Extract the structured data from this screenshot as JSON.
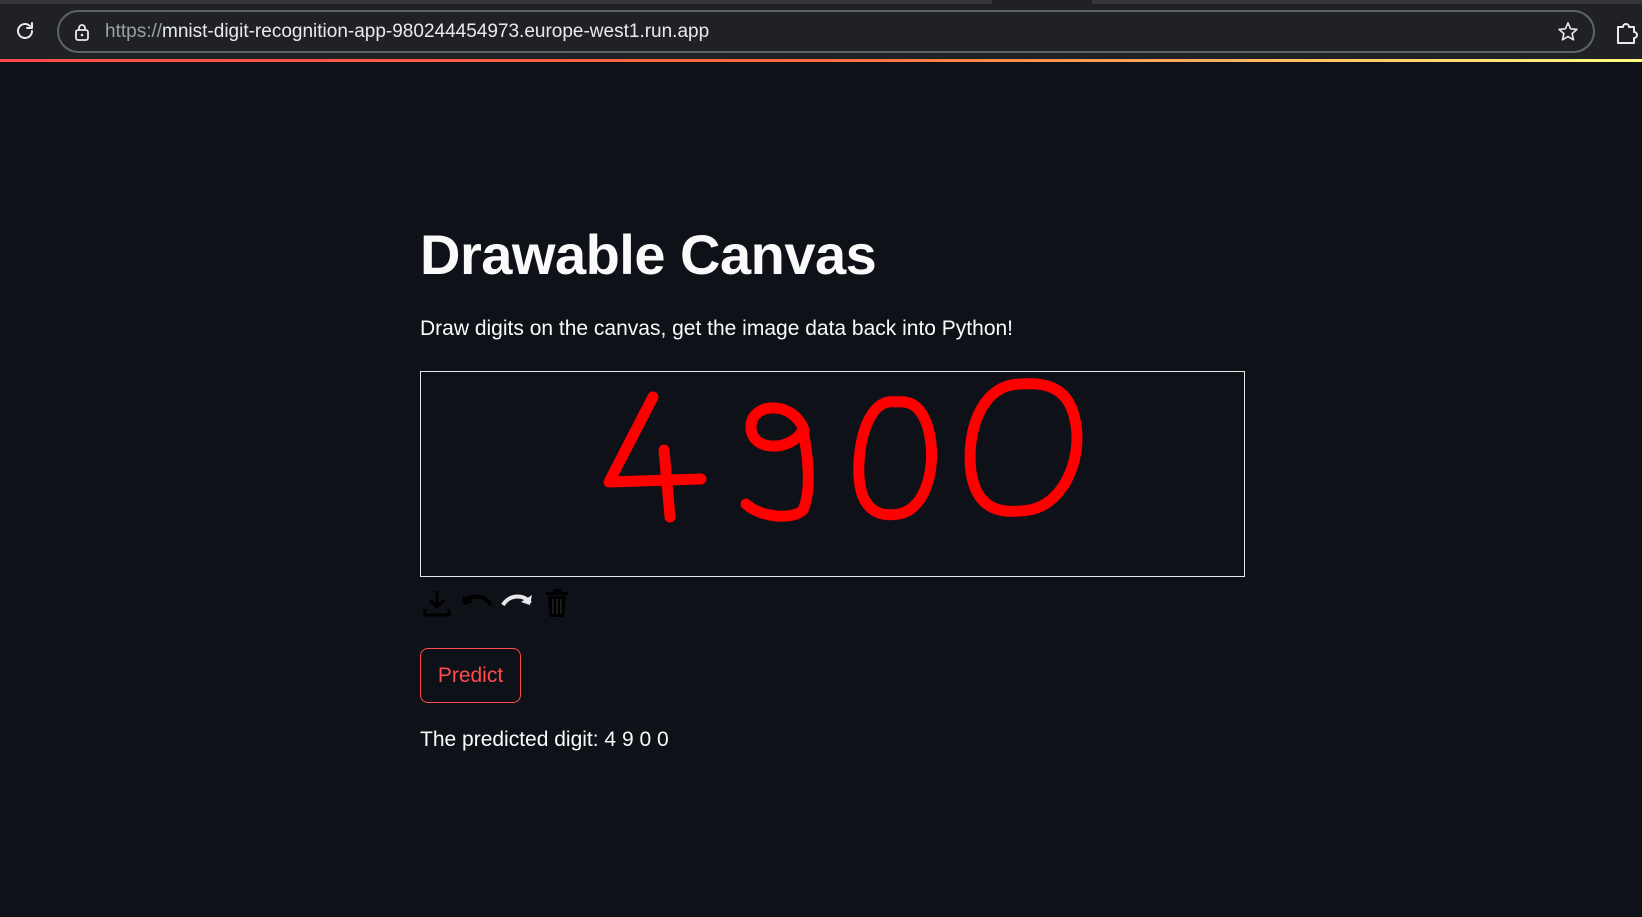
{
  "browser": {
    "url_scheme": "https://",
    "url_host": "mnist-digit-recognition-app-980244454973.europe-west1.run.app"
  },
  "app": {
    "title": "Drawable Canvas",
    "subtitle": "Draw digits on the canvas, get the image data back into Python!",
    "canvas": {
      "stroke_color": "#ff0000",
      "background_color": "#0e1117",
      "drawn_digits": [
        "4",
        "9",
        "0",
        "0"
      ]
    },
    "toolbar": {
      "icons": [
        "download-icon",
        "undo-icon",
        "redo-icon",
        "trash-icon"
      ]
    },
    "predict_button_label": "Predict",
    "result_text": "The predicted digit: 4 9 0 0"
  },
  "colors": {
    "accent": "#ff4b4b",
    "background": "#0e1117",
    "text": "#fafafa"
  }
}
